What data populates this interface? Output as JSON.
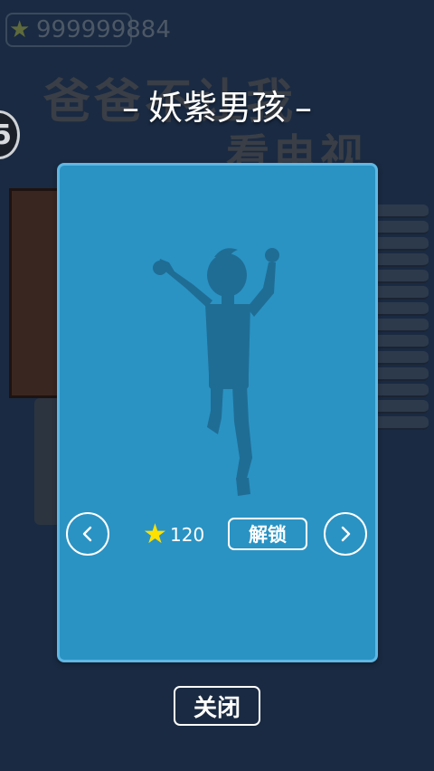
{
  "background": {
    "game_title_line1": "爸爸不让我",
    "game_title_line2": "看电视",
    "coins_value": "999999884",
    "level_number": "5",
    "coin_icon": "star-icon"
  },
  "dialog": {
    "title": "妖紫男孩",
    "title_dash": "–",
    "price_icon": "star-icon",
    "price": "120",
    "unlock_label": "解锁",
    "close_label": "关闭",
    "prev_icon": "chevron-left-icon",
    "next_icon": "chevron-right-icon"
  },
  "colors": {
    "card_bg": "#2a93c3",
    "card_border": "#5fb7e3",
    "star": "#ffe100",
    "silhouette": "#1f6d95"
  }
}
